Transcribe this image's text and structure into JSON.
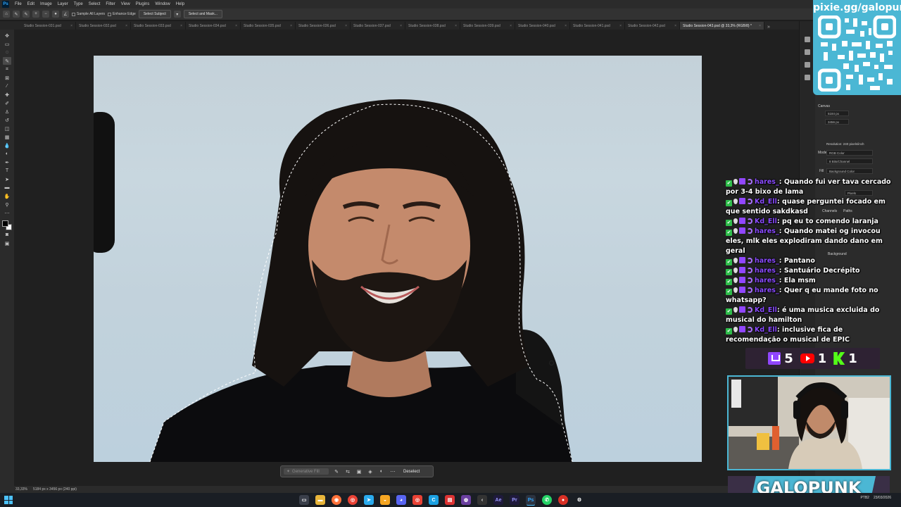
{
  "app": {
    "logo": "Ps"
  },
  "menu": [
    "File",
    "Edit",
    "Image",
    "Layer",
    "Type",
    "Select",
    "Filter",
    "View",
    "Plugins",
    "Window",
    "Help"
  ],
  "options_bar": {
    "sample_all_layers": "Sample All Layers",
    "enhance_edge": "Enhance Edge",
    "select_subject": "Select Subject",
    "select_and_mask": "Select and Mask..."
  },
  "tabs": [
    {
      "label": "Studio Session-031.psd"
    },
    {
      "label": "Studio Session-032.psd"
    },
    {
      "label": "Studio Session-033.psd"
    },
    {
      "label": "Studio Session-034.psd"
    },
    {
      "label": "Studio Session-035.psd"
    },
    {
      "label": "Studio Session-036.psd"
    },
    {
      "label": "Studio Session-037.psd"
    },
    {
      "label": "Studio Session-038.psd"
    },
    {
      "label": "Studio Session-039.psd"
    },
    {
      "label": "Studio Session-040.psd"
    },
    {
      "label": "Studio Session-041.psd"
    },
    {
      "label": "Studio Session-042.psd"
    },
    {
      "label": "Studio Session-043.psd @ 33,3% (RGB/8) *",
      "active": true
    }
  ],
  "context_bar": {
    "generative_fill": "Generative Fill",
    "deselect": "Deselect"
  },
  "status_bar": {
    "zoom": "33,33%",
    "doc_size": "5184 px x 3456 px (240 ppi)"
  },
  "properties": {
    "canvas_label": "Canvas",
    "width": "5184 px",
    "height": "3456 px",
    "resolution": "Resolution: 240 pixels/inch",
    "mode_label": "Mode",
    "mode": "RGB Color",
    "bits": "8 Bits/Channel",
    "fill_label": "Fill",
    "fill": "Background Color",
    "channels": "Channels",
    "paths": "Paths",
    "layer_name": "Background",
    "units": "Pixels"
  },
  "overlay": {
    "qr_url": "pixie.gg/galopunk",
    "chat": [
      {
        "user": "hares_",
        "text": "Quando fui ver tava cercado por 3-4 bixo de lama"
      },
      {
        "user": "Kd_Ell",
        "text": "quase perguntei focado em que sentido sakdkasd"
      },
      {
        "user": "Kd_Ell",
        "text": "pq eu to comendo laranja"
      },
      {
        "user": "hares_",
        "text": "Quando matei og invocou eles, mlk eles explodiram dando dano em geral"
      },
      {
        "user": "hares_",
        "text": "Pantano"
      },
      {
        "user": "hares_",
        "text": "Santuário Decrépito"
      },
      {
        "user": "hares_",
        "text": "Ela msm"
      },
      {
        "user": "hares_",
        "text": "Quer q eu mande foto no whatsapp?"
      },
      {
        "user": "Kd_Ell",
        "text": "é uma musica excluida do musical do hamilton"
      },
      {
        "user": "Kd_Ell",
        "text": "inclusive fica de recomendação o musical de EPIC"
      }
    ],
    "viewers": {
      "twitch": "5",
      "youtube": "1",
      "kick": "1"
    },
    "brand": "GALOPUNK"
  },
  "system_tray": {
    "lang": "PTB2",
    "date": "23/03/2026"
  },
  "colors": {
    "accent": "#4bb7d4",
    "twitch": "#9146ff",
    "youtube": "#ff0000",
    "kick": "#53fc18",
    "chat_user": "#8a4bff"
  }
}
